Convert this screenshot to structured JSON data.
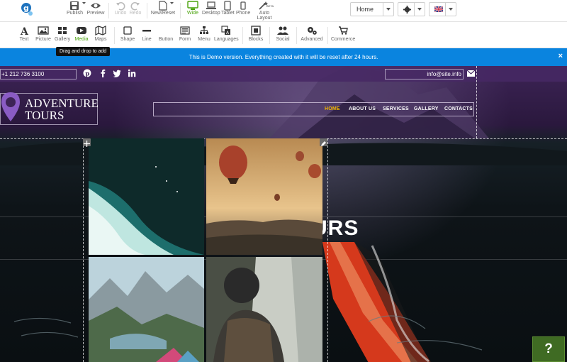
{
  "toolbar": {
    "publish": "Publish",
    "preview": "Preview",
    "undo": "Undo",
    "redo": "Redo",
    "new_reset": "New/Reset",
    "wide": "Wide",
    "desktop": "Desktop",
    "tablet": "Tablet",
    "phone": "Phone",
    "auto_layout": "Auto Layout",
    "beta": "BETA",
    "page_select": "Home"
  },
  "elements": {
    "text": "Text",
    "picture": "Picture",
    "gallery": "Gallery",
    "media": "Media",
    "maps": "Maps",
    "shape": "Shape",
    "line": "Line",
    "button": "Button",
    "form": "Form",
    "menu": "Menu",
    "languages": "Languages",
    "blocks": "Blocks",
    "social": "Social",
    "advanced": "Advanced",
    "commerce": "Commerce"
  },
  "tooltip": "Drag and drop to add",
  "banner": {
    "message": "This is Demo version. Everything created with it will be reset after 24 hours.",
    "close": "×"
  },
  "site": {
    "phone": "+1 212 736 3100",
    "email": "info@site.info",
    "brand_line1": "ADVENTURE",
    "brand_line2": "TOURS",
    "nav": [
      "HOME",
      "ABOUT US",
      "SERVICES",
      "GALLERY",
      "CONTACTS"
    ],
    "hero_partial": "URS"
  },
  "help": "?",
  "colors": {
    "accent_green": "#4aa30b",
    "banner_blue": "#0a84df",
    "nav_active": "#f0b400",
    "brand_purple": "#8a5cc4"
  }
}
